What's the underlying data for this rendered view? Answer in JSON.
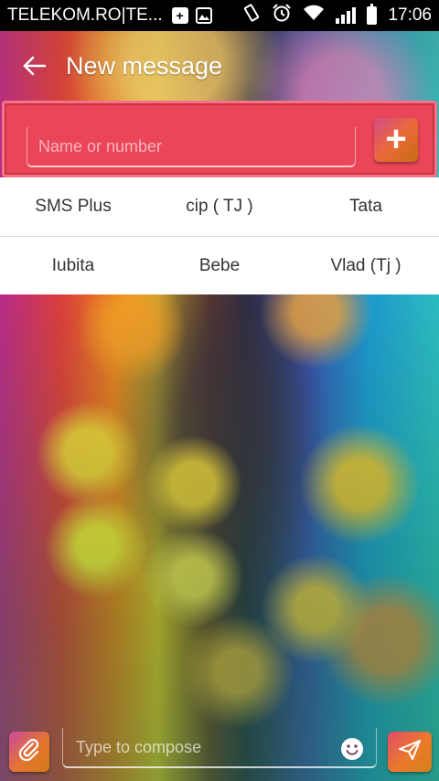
{
  "status_bar": {
    "carrier": "TELEKOM.RO|TE...",
    "time": "17:06",
    "icons": [
      "plus-box-icon",
      "image-icon",
      "vibrate-icon",
      "alarm-icon",
      "wifi-icon",
      "signal-icon",
      "battery-icon"
    ]
  },
  "header": {
    "title": "New message",
    "back_icon": "arrow-left-icon"
  },
  "recipient": {
    "placeholder": "Name or number",
    "value": "",
    "add_icon": "plus-icon"
  },
  "contacts": {
    "rows": [
      [
        "SMS Plus",
        "cip ( TJ )",
        "Tata"
      ],
      [
        "Iubita",
        "Bebe",
        "Vlad (Tj )"
      ]
    ]
  },
  "compose": {
    "placeholder": "Type to compose",
    "value": "",
    "attach_icon": "paperclip-icon",
    "emoji_icon": "smiley-icon",
    "send_icon": "send-icon"
  },
  "colors": {
    "recipient_bar": "#ea4558",
    "status_bar": "#000000",
    "contacts_bg": "#ffffff"
  }
}
